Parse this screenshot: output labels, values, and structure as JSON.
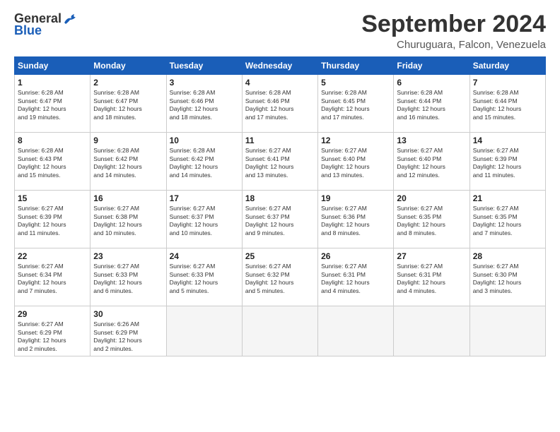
{
  "logo": {
    "general": "General",
    "blue": "Blue"
  },
  "title": "September 2024",
  "subtitle": "Churuguara, Falcon, Venezuela",
  "headers": [
    "Sunday",
    "Monday",
    "Tuesday",
    "Wednesday",
    "Thursday",
    "Friday",
    "Saturday"
  ],
  "weeks": [
    [
      {
        "day": "1",
        "info": "Sunrise: 6:28 AM\nSunset: 6:47 PM\nDaylight: 12 hours\nand 19 minutes."
      },
      {
        "day": "2",
        "info": "Sunrise: 6:28 AM\nSunset: 6:47 PM\nDaylight: 12 hours\nand 18 minutes."
      },
      {
        "day": "3",
        "info": "Sunrise: 6:28 AM\nSunset: 6:46 PM\nDaylight: 12 hours\nand 18 minutes."
      },
      {
        "day": "4",
        "info": "Sunrise: 6:28 AM\nSunset: 6:46 PM\nDaylight: 12 hours\nand 17 minutes."
      },
      {
        "day": "5",
        "info": "Sunrise: 6:28 AM\nSunset: 6:45 PM\nDaylight: 12 hours\nand 17 minutes."
      },
      {
        "day": "6",
        "info": "Sunrise: 6:28 AM\nSunset: 6:44 PM\nDaylight: 12 hours\nand 16 minutes."
      },
      {
        "day": "7",
        "info": "Sunrise: 6:28 AM\nSunset: 6:44 PM\nDaylight: 12 hours\nand 15 minutes."
      }
    ],
    [
      {
        "day": "8",
        "info": "Sunrise: 6:28 AM\nSunset: 6:43 PM\nDaylight: 12 hours\nand 15 minutes."
      },
      {
        "day": "9",
        "info": "Sunrise: 6:28 AM\nSunset: 6:42 PM\nDaylight: 12 hours\nand 14 minutes."
      },
      {
        "day": "10",
        "info": "Sunrise: 6:28 AM\nSunset: 6:42 PM\nDaylight: 12 hours\nand 14 minutes."
      },
      {
        "day": "11",
        "info": "Sunrise: 6:27 AM\nSunset: 6:41 PM\nDaylight: 12 hours\nand 13 minutes."
      },
      {
        "day": "12",
        "info": "Sunrise: 6:27 AM\nSunset: 6:40 PM\nDaylight: 12 hours\nand 13 minutes."
      },
      {
        "day": "13",
        "info": "Sunrise: 6:27 AM\nSunset: 6:40 PM\nDaylight: 12 hours\nand 12 minutes."
      },
      {
        "day": "14",
        "info": "Sunrise: 6:27 AM\nSunset: 6:39 PM\nDaylight: 12 hours\nand 11 minutes."
      }
    ],
    [
      {
        "day": "15",
        "info": "Sunrise: 6:27 AM\nSunset: 6:39 PM\nDaylight: 12 hours\nand 11 minutes."
      },
      {
        "day": "16",
        "info": "Sunrise: 6:27 AM\nSunset: 6:38 PM\nDaylight: 12 hours\nand 10 minutes."
      },
      {
        "day": "17",
        "info": "Sunrise: 6:27 AM\nSunset: 6:37 PM\nDaylight: 12 hours\nand 10 minutes."
      },
      {
        "day": "18",
        "info": "Sunrise: 6:27 AM\nSunset: 6:37 PM\nDaylight: 12 hours\nand 9 minutes."
      },
      {
        "day": "19",
        "info": "Sunrise: 6:27 AM\nSunset: 6:36 PM\nDaylight: 12 hours\nand 8 minutes."
      },
      {
        "day": "20",
        "info": "Sunrise: 6:27 AM\nSunset: 6:35 PM\nDaylight: 12 hours\nand 8 minutes."
      },
      {
        "day": "21",
        "info": "Sunrise: 6:27 AM\nSunset: 6:35 PM\nDaylight: 12 hours\nand 7 minutes."
      }
    ],
    [
      {
        "day": "22",
        "info": "Sunrise: 6:27 AM\nSunset: 6:34 PM\nDaylight: 12 hours\nand 7 minutes."
      },
      {
        "day": "23",
        "info": "Sunrise: 6:27 AM\nSunset: 6:33 PM\nDaylight: 12 hours\nand 6 minutes."
      },
      {
        "day": "24",
        "info": "Sunrise: 6:27 AM\nSunset: 6:33 PM\nDaylight: 12 hours\nand 5 minutes."
      },
      {
        "day": "25",
        "info": "Sunrise: 6:27 AM\nSunset: 6:32 PM\nDaylight: 12 hours\nand 5 minutes."
      },
      {
        "day": "26",
        "info": "Sunrise: 6:27 AM\nSunset: 6:31 PM\nDaylight: 12 hours\nand 4 minutes."
      },
      {
        "day": "27",
        "info": "Sunrise: 6:27 AM\nSunset: 6:31 PM\nDaylight: 12 hours\nand 4 minutes."
      },
      {
        "day": "28",
        "info": "Sunrise: 6:27 AM\nSunset: 6:30 PM\nDaylight: 12 hours\nand 3 minutes."
      }
    ],
    [
      {
        "day": "29",
        "info": "Sunrise: 6:27 AM\nSunset: 6:29 PM\nDaylight: 12 hours\nand 2 minutes."
      },
      {
        "day": "30",
        "info": "Sunrise: 6:26 AM\nSunset: 6:29 PM\nDaylight: 12 hours\nand 2 minutes."
      },
      {
        "day": "",
        "info": ""
      },
      {
        "day": "",
        "info": ""
      },
      {
        "day": "",
        "info": ""
      },
      {
        "day": "",
        "info": ""
      },
      {
        "day": "",
        "info": ""
      }
    ]
  ]
}
